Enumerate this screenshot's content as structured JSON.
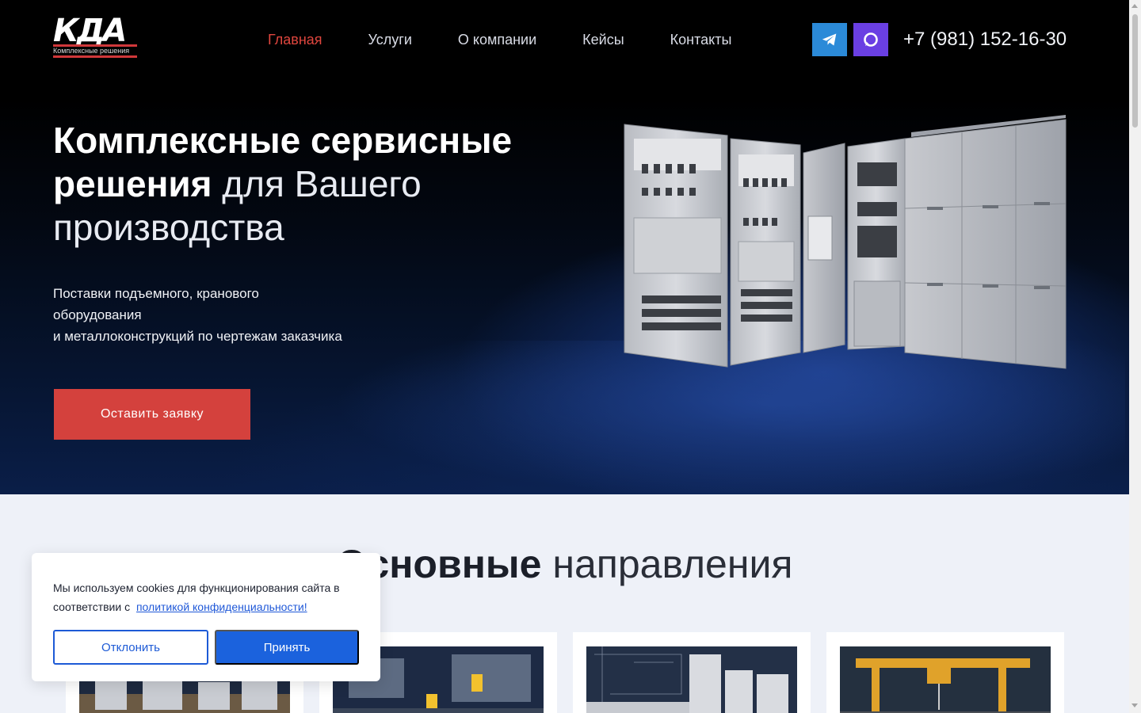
{
  "brand": {
    "logo_mark": "КДА",
    "logo_sub": "Комплексные решения"
  },
  "nav": {
    "items": [
      {
        "label": "Главная",
        "active": true
      },
      {
        "label": "Услуги"
      },
      {
        "label": "О компании"
      },
      {
        "label": "Кейсы"
      },
      {
        "label": "Контакты"
      }
    ]
  },
  "social": [
    {
      "icon": "telegram-icon",
      "color": "#2b8ad8"
    },
    {
      "icon": "max-messenger-icon",
      "color": "#6a3fe3"
    }
  ],
  "phone": "+7 (981) 152-16-30",
  "hero": {
    "title_bold_1": "Комплексные сервисные",
    "title_bold_2": "решения",
    "title_light_1": "для Вашего",
    "title_light_2": "производства",
    "subtitle_lines": [
      "Поставки подъемного, кранового",
      "оборудования",
      "и металлоконструкций по чертежам заказчика"
    ],
    "cta_label": "Оставить заявку"
  },
  "directions": {
    "title_bold": "Основные",
    "title_light": "направления"
  },
  "cookie": {
    "text": "Мы используем cookies для функционирования сайта в соответствии с",
    "link": "политикой конфиденциальности!",
    "decline_label": "Отклонить",
    "accept_label": "Принять"
  },
  "colors": {
    "accent_red": "#d4413d",
    "nav_active": "#e0463e",
    "primary_blue": "#1b62dd"
  }
}
